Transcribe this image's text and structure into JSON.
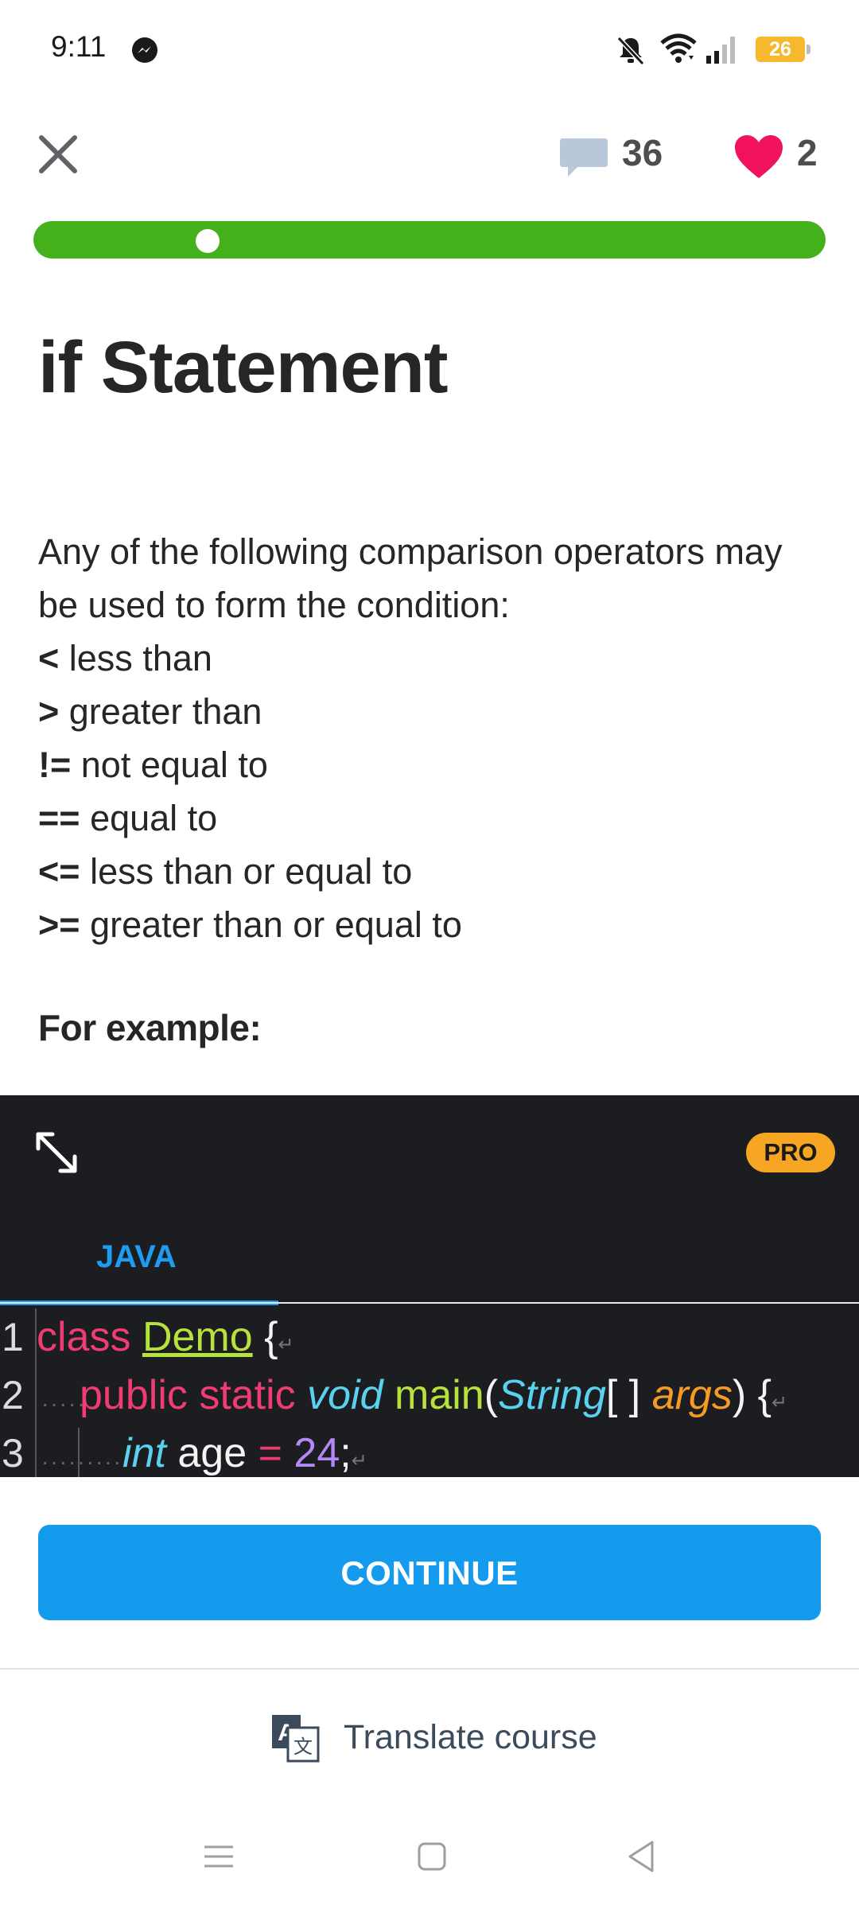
{
  "status_bar": {
    "time": "9:11",
    "battery": "26",
    "icons": [
      "messenger-icon",
      "mute-bell-icon",
      "wifi-icon",
      "signal-icon",
      "battery-icon"
    ]
  },
  "header": {
    "comments_count": "36",
    "hearts_count": "2",
    "progress": 1.0,
    "colors": {
      "progress": "#44b01c",
      "heart": "#f0125a",
      "comment": "#b6c3d6"
    }
  },
  "lesson": {
    "title": "if Statement",
    "intro": "Any of the following comparison operators may be used to form the condition:",
    "operators": [
      {
        "symbol": "<",
        "text": " less than"
      },
      {
        "symbol": ">",
        "text": " greater than"
      },
      {
        "symbol": "!=",
        "text": " not equal to"
      },
      {
        "symbol": "==",
        "text": " equal to"
      },
      {
        "symbol": "<=",
        "text": " less than or equal to"
      },
      {
        "symbol": ">=",
        "text": " greater than or equal to"
      }
    ],
    "for_example": "For example:"
  },
  "code": {
    "badge": "PRO",
    "tab": "JAVA",
    "line_numbers": [
      "1",
      "2",
      "3"
    ],
    "line1": {
      "kw": "class",
      "name": "Demo",
      "brace": "{"
    },
    "line2": {
      "mods": "public static",
      "ret": "void",
      "fn": "main",
      "lp": "(",
      "type": "String",
      "arr": "[ ]",
      "param": "args",
      "rp": ") {"
    },
    "line3": {
      "type": "int",
      "name": "age",
      "eq": "=",
      "num": "24",
      "semi": ";"
    }
  },
  "actions": {
    "continue": "CONTINUE",
    "translate": "Translate course",
    "colors": {
      "continue": "#149bee"
    }
  }
}
